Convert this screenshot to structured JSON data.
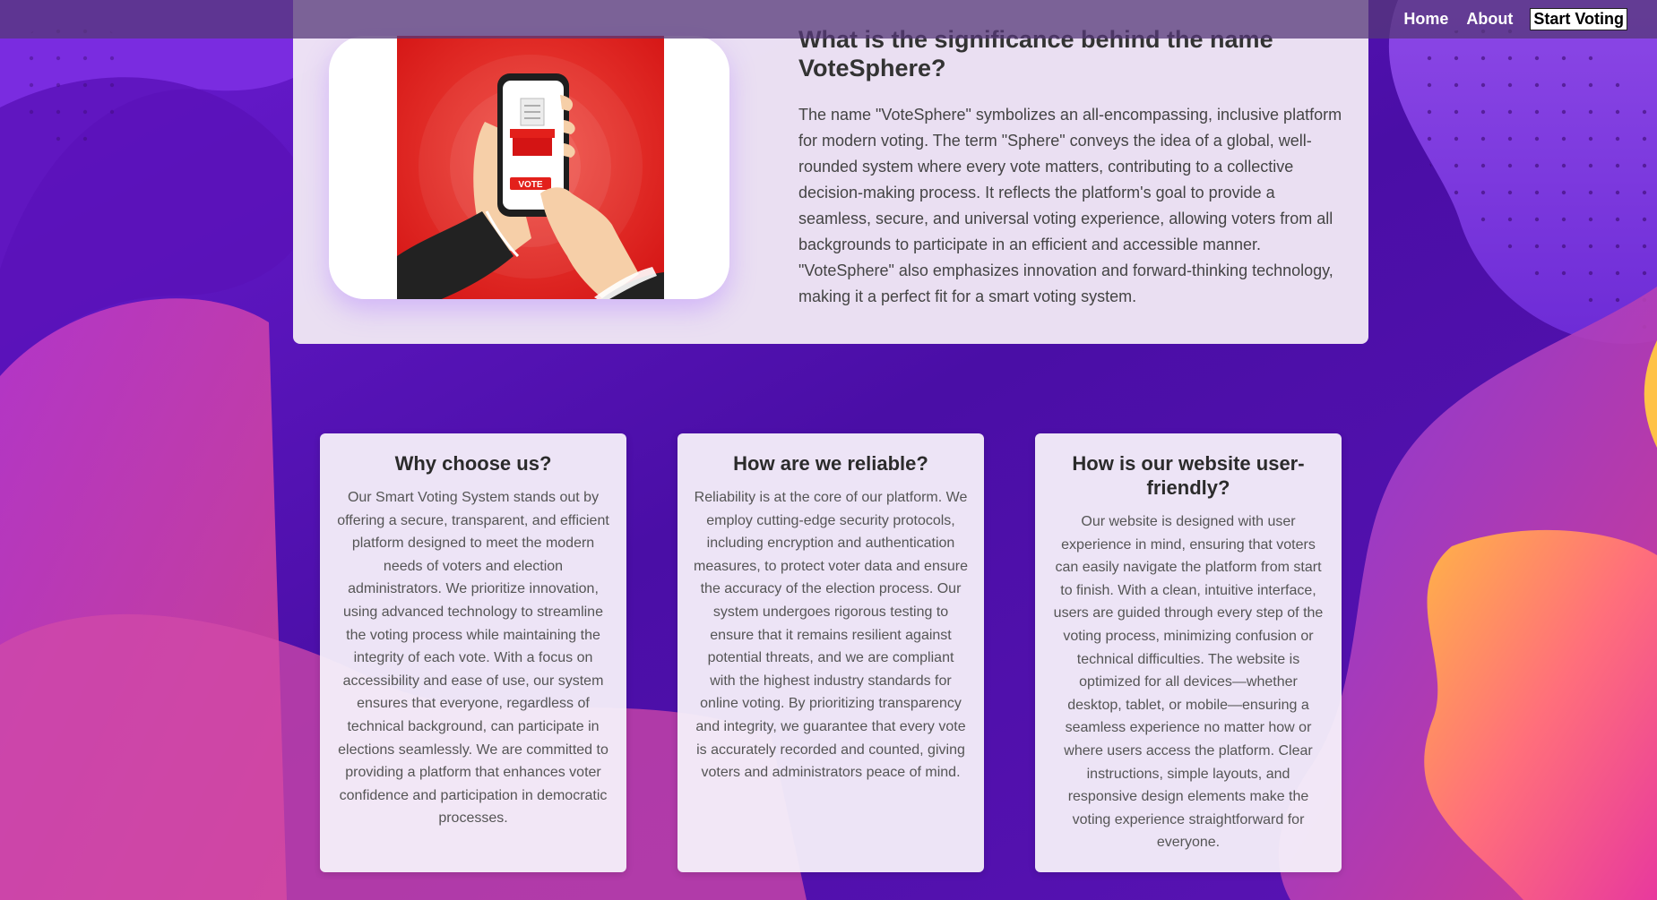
{
  "nav": {
    "links": [
      {
        "label": "Home"
      },
      {
        "label": "About"
      },
      {
        "label": "Start Voting"
      }
    ]
  },
  "about_name": {
    "title": "What is the significance behind the name VoteSphere?",
    "body": "The name \"VoteSphere\" symbolizes an all-encompassing, inclusive platform for modern voting. The term \"Sphere\" conveys the idea of a global, well-rounded system where every vote matters, contributing to a collective decision-making process. It reflects the platform's goal to provide a seamless, secure, and universal voting experience, allowing voters from all backgrounds to participate in an efficient and accessible manner. \"VoteSphere\" also emphasizes innovation and forward-thinking technology, making it a perfect fit for a smart voting system.",
    "image": {
      "button_text": "VOTE",
      "icon": "phone-vote-illustration"
    }
  },
  "features": [
    {
      "title": "Why choose us?",
      "body": "Our Smart Voting System stands out by offering a secure, transparent, and efficient platform designed to meet the modern needs of voters and election administrators. We prioritize innovation, using advanced technology to streamline the voting process while maintaining the integrity of each vote. With a focus on accessibility and ease of use, our system ensures that everyone, regardless of technical background, can participate in elections seamlessly. We are committed to providing a platform that enhances voter confidence and participation in democratic processes."
    },
    {
      "title": "How are we reliable?",
      "body": "Reliability is at the core of our platform. We employ cutting-edge security protocols, including encryption and authentication measures, to protect voter data and ensure the accuracy of the election process. Our system undergoes rigorous testing to ensure that it remains resilient against potential threats, and we are compliant with the highest industry standards for online voting. By prioritizing transparency and integrity, we guarantee that every vote is accurately recorded and counted, giving voters and administrators peace of mind."
    },
    {
      "title": "How is our website user-friendly?",
      "body": "Our website is designed with user experience in mind, ensuring that voters can easily navigate the platform from start to finish. With a clean, intuitive interface, users are guided through every step of the voting process, minimizing confusion or technical difficulties. The website is optimized for all devices—whether desktop, tablet, or mobile—ensuring a seamless experience no matter how or where users access the platform. Clear instructions, simple layouts, and responsive design elements make the voting experience straightforward for everyone."
    }
  ],
  "colors": {
    "background": "#4a0fa3",
    "nav_bar": "#563878",
    "card": "#f0e8f5",
    "accent_red": "#e3201b"
  }
}
